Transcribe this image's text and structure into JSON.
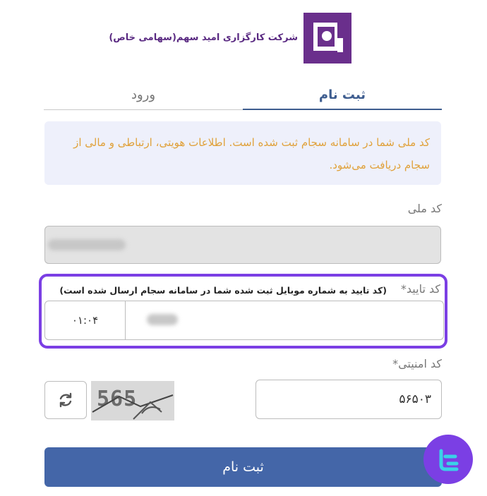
{
  "header": {
    "company_name": "شرکت کارگزاری امید سهم(سهامی خاص)"
  },
  "tabs": [
    {
      "label": "ثبت نام",
      "active": true
    },
    {
      "label": "ورود",
      "active": false
    }
  ],
  "notice": {
    "text": "کد ملی شما در سامانه سجام ثبت شده است. اطلاعات هویتی، ارتباطی و مالی از سجام دریافت می‌شود."
  },
  "national_code": {
    "label": "کد ملی"
  },
  "verification": {
    "label": "کد تایید*",
    "hint": "(کد تایید به شماره موبایل ثبت شده شما در سامانه سجام ارسال شده است)",
    "timer": "۰۱:۰۴"
  },
  "security": {
    "label": "کد امنیتی*",
    "captcha_text": "565",
    "value": "۵۶۵۰۳"
  },
  "submit": {
    "label": "ثبت نام"
  },
  "colors": {
    "accent": "#4466a8",
    "highlight": "#7b3fe4",
    "brand": "#6a2f8c",
    "notice_text": "#e0a13a"
  }
}
